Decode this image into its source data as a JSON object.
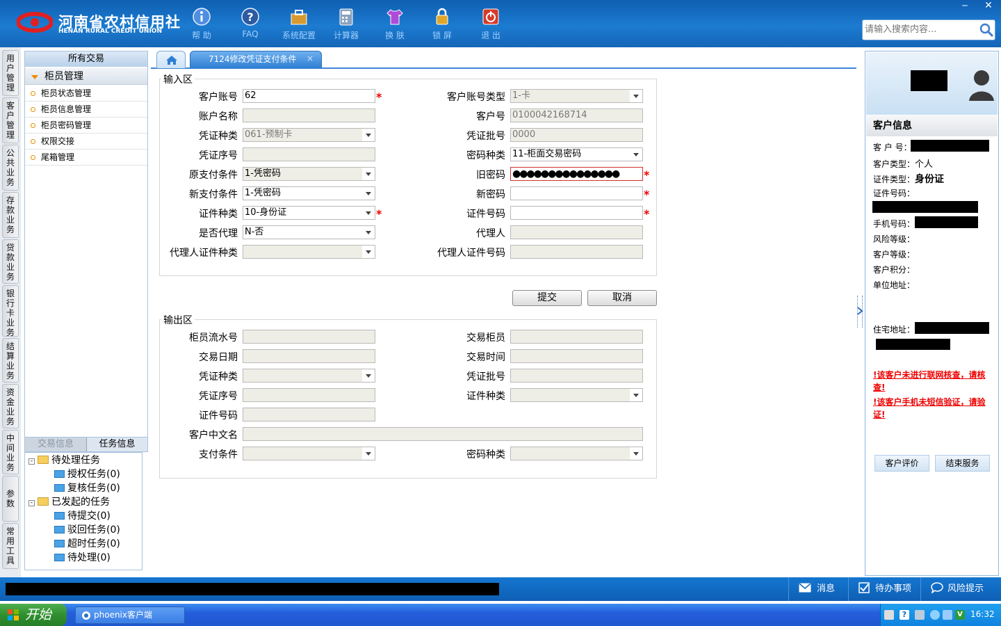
{
  "header": {
    "logo_cn": "河南省农村信用社",
    "logo_en": "HENAN RURAL CREDIT UNION",
    "toolbar": [
      {
        "label": "帮 助",
        "icon": "info-icon"
      },
      {
        "label": "FAQ",
        "icon": "question-icon"
      },
      {
        "label": "系统配置",
        "icon": "toolbox-icon"
      },
      {
        "label": "计算器",
        "icon": "calculator-icon"
      },
      {
        "label": "换 肤",
        "icon": "shirt-icon"
      },
      {
        "label": "锁 屏",
        "icon": "lock-icon"
      },
      {
        "label": "退 出",
        "icon": "power-icon"
      }
    ],
    "search_placeholder": "请输入搜索内容...",
    "win_min": "‒",
    "win_close": "✕"
  },
  "vertical_tabs": [
    "用户管理",
    "客户管理",
    "公共业务",
    "存款业务",
    "贷款业务",
    "银行卡业务",
    "结算业务",
    "资金业务",
    "中间业务",
    "参数",
    "常用工具"
  ],
  "nav": {
    "header": "所有交易",
    "group": "柜员管理",
    "items": [
      "柜员状态管理",
      "柜员信息管理",
      "柜员密码管理",
      "权限交接",
      "尾箱管理"
    ]
  },
  "task_panel": {
    "tabs": [
      "交易信息",
      "任务信息"
    ],
    "tree": {
      "pending": "待处理任务",
      "pending_items": [
        "授权任务(0)",
        "复核任务(0)"
      ],
      "initiated": "已发起的任务",
      "initiated_items": [
        "待提交(0)",
        "驳回任务(0)",
        "超时任务(0)",
        "待处理(0)"
      ]
    }
  },
  "tabs": {
    "home_icon": "home-icon",
    "active": "7124修改凭证支付条件",
    "close": "×"
  },
  "input_area": {
    "legend": "输入区",
    "fields": {
      "account_no": {
        "label": "客户账号",
        "value": "62"
      },
      "account_type": {
        "label": "客户账号类型",
        "value": "1-卡"
      },
      "account_name": {
        "label": "账户名称",
        "value": ""
      },
      "customer_no": {
        "label": "客户号",
        "value": "0100042168714"
      },
      "voucher_type": {
        "label": "凭证种类",
        "value": "061-预制卡"
      },
      "voucher_batch": {
        "label": "凭证批号",
        "value": "0000"
      },
      "voucher_seq": {
        "label": "凭证序号",
        "value": ""
      },
      "pwd_type": {
        "label": "密码种类",
        "value": "11-柜面交易密码"
      },
      "orig_pay_cond": {
        "label": "原支付条件",
        "value": "1-凭密码"
      },
      "old_pwd": {
        "label": "旧密码",
        "value": "●●●●●●●●●●●●●●●"
      },
      "new_pay_cond": {
        "label": "新支付条件",
        "value": "1-凭密码"
      },
      "new_pwd": {
        "label": "新密码",
        "value": ""
      },
      "id_type": {
        "label": "证件种类",
        "value": "10-身份证"
      },
      "id_no": {
        "label": "证件号码",
        "value": ""
      },
      "is_agent": {
        "label": "是否代理",
        "value": "N-否"
      },
      "agent": {
        "label": "代理人",
        "value": ""
      },
      "agent_id_type": {
        "label": "代理人证件种类",
        "value": ""
      },
      "agent_id_no": {
        "label": "代理人证件号码",
        "value": ""
      }
    },
    "required_mark": "*"
  },
  "buttons": {
    "submit": "提交",
    "cancel": "取消"
  },
  "output_area": {
    "legend": "输出区",
    "labels": {
      "teller_serial": "柜员流水号",
      "trade_teller": "交易柜员",
      "trade_date": "交易日期",
      "trade_time": "交易时间",
      "voucher_type": "凭证种类",
      "voucher_batch": "凭证批号",
      "voucher_seq": "凭证序号",
      "id_type": "证件种类",
      "id_no": "证件号码",
      "cn_name": "客户中文名",
      "pay_cond": "支付条件",
      "pwd_type": "密码种类"
    }
  },
  "customer_panel": {
    "title": "客户信息",
    "rows": {
      "cust_no": "客 户 号：",
      "cust_type": "客户类型：",
      "cust_type_value": "个人",
      "id_type": "证件类型：",
      "id_type_value": "身份证",
      "id_no": "证件号码：",
      "phone": "手机号码：",
      "risk": "风险等级：",
      "level": "客户等级：",
      "points": "客户积分：",
      "work_addr": "单位地址：",
      "home_addr": "住宅地址："
    },
    "warnings": [
      "!该客户未进行联网核查，请核查!",
      "!该客户手机未短信验证，请验证!"
    ],
    "buttons": {
      "rate": "客户评价",
      "end": "结束服务"
    }
  },
  "status_bar": {
    "messages": "消息",
    "todo": "待办事项",
    "risk": "风险提示"
  },
  "taskbar": {
    "start": "开始",
    "app": "phoenix客户端",
    "clock": "16:32"
  },
  "colors": {
    "header_blue": "#1466b8",
    "required_red": "#e00000",
    "warning_red": "#e00000"
  }
}
